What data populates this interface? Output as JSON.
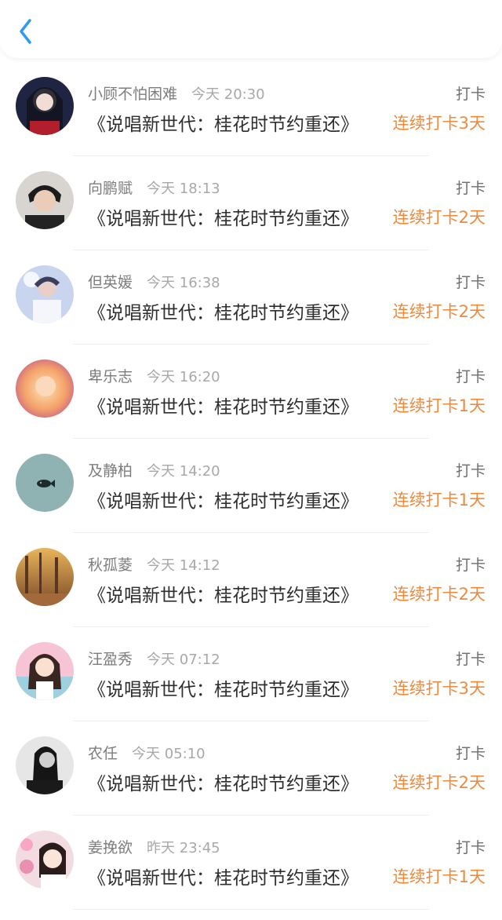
{
  "header": {
    "back_icon": "chevron-left-icon",
    "accent": "#2d9cf0"
  },
  "colors": {
    "streak": "#ee8a3e",
    "title": "#2e2e2e",
    "name": "#7d7d7d"
  },
  "entries": [
    {
      "name": "小顾不怕困难",
      "time": "今天 20:30",
      "title": "《说唱新世代：桂花时节约重还》",
      "action": "打卡",
      "streak": "连续打卡3天"
    },
    {
      "name": "向鹏赋",
      "time": "今天 18:13",
      "title": "《说唱新世代：桂花时节约重还》",
      "action": "打卡",
      "streak": "连续打卡2天"
    },
    {
      "name": "但英媛",
      "time": "今天 16:38",
      "title": "《说唱新世代：桂花时节约重还》",
      "action": "打卡",
      "streak": "连续打卡2天"
    },
    {
      "name": "卑乐志",
      "time": "今天 16:20",
      "title": "《说唱新世代：桂花时节约重还》",
      "action": "打卡",
      "streak": "连续打卡1天"
    },
    {
      "name": "及静柏",
      "time": "今天 14:20",
      "title": "《说唱新世代：桂花时节约重还》",
      "action": "打卡",
      "streak": "连续打卡1天"
    },
    {
      "name": "秋孤菱",
      "time": "今天 14:12",
      "title": "《说唱新世代：桂花时节约重还》",
      "action": "打卡",
      "streak": "连续打卡2天"
    },
    {
      "name": "汪盈秀",
      "time": "今天 07:12",
      "title": "《说唱新世代：桂花时节约重还》",
      "action": "打卡",
      "streak": "连续打卡3天"
    },
    {
      "name": "农任",
      "time": "今天 05:10",
      "title": "《说唱新世代：桂花时节约重还》",
      "action": "打卡",
      "streak": "连续打卡2天"
    },
    {
      "name": "姜挽欲",
      "time": "昨天 23:45",
      "title": "《说唱新世代：桂花时节约重还》",
      "action": "打卡",
      "streak": "连续打卡1天"
    }
  ]
}
